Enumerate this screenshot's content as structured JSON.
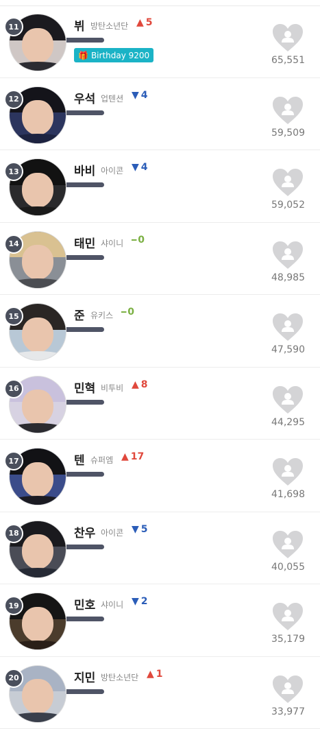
{
  "ranking": [
    {
      "rank": "11",
      "name": "뷔",
      "group": "방탄소년단",
      "change_dir": "up",
      "change": "5",
      "votes": "65,551",
      "badge": "Birthday 9200",
      "hair": "#1b1a1f",
      "bg": "#cfc7c5",
      "shirt": "#2c2c32"
    },
    {
      "rank": "12",
      "name": "우석",
      "group": "업텐션",
      "change_dir": "down",
      "change": "4",
      "votes": "59,509",
      "hair": "#14141a",
      "bg": "#2c355e",
      "shirt": "#1d2340"
    },
    {
      "rank": "13",
      "name": "바비",
      "group": "아이콘",
      "change_dir": "down",
      "change": "4",
      "votes": "59,052",
      "hair": "#121212",
      "bg": "#2a2a2c",
      "shirt": "#1a1a1a"
    },
    {
      "rank": "14",
      "name": "태민",
      "group": "샤이니",
      "change_dir": "same",
      "change": "0",
      "votes": "48,985",
      "hair": "#d9c191",
      "bg": "#8a8f96",
      "shirt": "#4b4d52"
    },
    {
      "rank": "15",
      "name": "준",
      "group": "유키스",
      "change_dir": "same",
      "change": "0",
      "votes": "47,590",
      "hair": "#2a2624",
      "bg": "#b8c8d6",
      "shirt": "#e6e8ea"
    },
    {
      "rank": "16",
      "name": "민혁",
      "group": "비투비",
      "change_dir": "up",
      "change": "8",
      "votes": "44,295",
      "hair": "#c9c1dd",
      "bg": "#d7d2e2",
      "shirt": "#2b2b30"
    },
    {
      "rank": "17",
      "name": "텐",
      "group": "슈퍼엠",
      "change_dir": "up",
      "change": "17",
      "votes": "41,698",
      "hair": "#121215",
      "bg": "#3b4c8a",
      "shirt": "#1b1b22"
    },
    {
      "rank": "18",
      "name": "찬우",
      "group": "아이콘",
      "change_dir": "down",
      "change": "5",
      "votes": "40,055",
      "hair": "#1a1a1e",
      "bg": "#4a4c56",
      "shirt": "#262a35"
    },
    {
      "rank": "19",
      "name": "민호",
      "group": "샤이니",
      "change_dir": "down",
      "change": "2",
      "votes": "35,179",
      "hair": "#151515",
      "bg": "#4b3c2c",
      "shirt": "#2a1f18"
    },
    {
      "rank": "20",
      "name": "지민",
      "group": "방탄소년단",
      "change_dir": "up",
      "change": "1",
      "votes": "33,977",
      "hair": "#a9b3c4",
      "bg": "#c7ccd4",
      "shirt": "#3a3f4b"
    }
  ],
  "icons": {
    "heart": "heart-with-person-icon",
    "gift": "gift-icon",
    "up": "triangle-up-icon",
    "down": "triangle-down-icon",
    "same": "dash-icon"
  },
  "colors": {
    "up": "#e0483c",
    "down": "#2b5db8",
    "same": "#7bb043",
    "badge": "#1bb3c6",
    "heart": "#d4d4d6",
    "rank_circle": "#4a4f5c"
  }
}
